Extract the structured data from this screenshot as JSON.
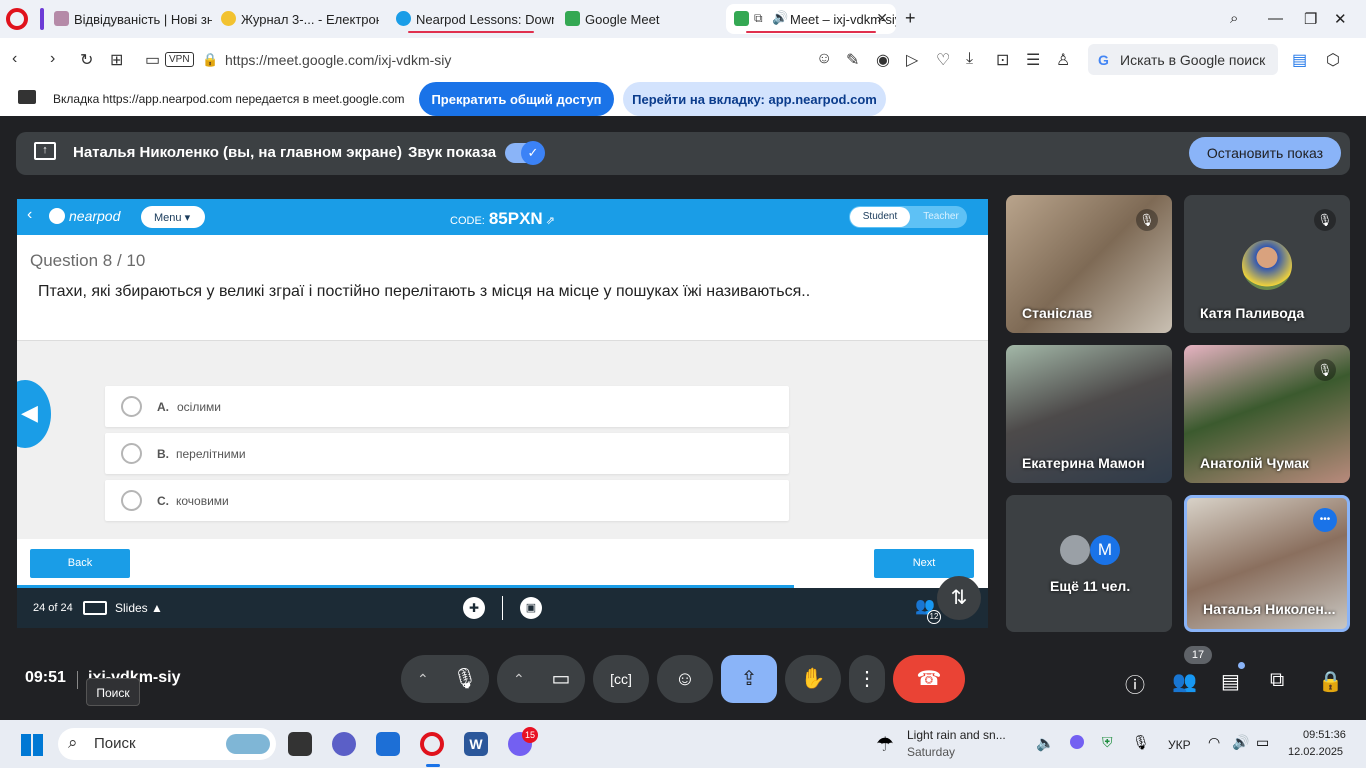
{
  "browser": {
    "tabs": [
      {
        "label": "Відвідуваність | Нові знан"
      },
      {
        "label": "Журнал 3-... - Електронні"
      },
      {
        "label": "Nearpod Lessons: Downlo"
      },
      {
        "label": "Google Meet"
      },
      {
        "label": "Meet – ixj-vdkm-siy"
      }
    ],
    "url": "https://meet.google.com/ixj-vdkm-siy",
    "vpn": "VPN",
    "search_placeholder": "Искать в Google поиск",
    "share_notice": "Вкладка https://app.nearpod.com передается в meet.google.com",
    "stop_sharing": "Прекратить общий доступ",
    "switch_tab": "Перейти на вкладку: app.nearpod.com"
  },
  "presenting": {
    "name": "Наталья Николенко (вы, на главном экране)",
    "audio_label": "Звук показа",
    "stop_label": "Остановить показ"
  },
  "nearpod": {
    "brand": "nearpod",
    "menu": "Menu",
    "code_label": "CODE:",
    "code": "85PXN",
    "student": "Student",
    "teacher": "Teacher",
    "question_num": "Question 8 / 10",
    "question": "Птахи, які збираються у великі зграї і постійно перелітають з місця на місце у пошуках їжі називаються..",
    "options": [
      {
        "letter": "A.",
        "text": "осілими"
      },
      {
        "letter": "B.",
        "text": "перелітними"
      },
      {
        "letter": "C.",
        "text": "кочовими"
      }
    ],
    "back": "Back",
    "next": "Next",
    "slide_count": "24 of 24",
    "slides_label": "Slides",
    "participants_badge": "12"
  },
  "participants": [
    {
      "name": "Станіслав"
    },
    {
      "name": "Катя Паливода"
    },
    {
      "name": "Екатерина Мамон"
    },
    {
      "name": "Анатолій Чумак"
    },
    {
      "name": "Ещё 11 чел.",
      "avatar_letter": "M"
    },
    {
      "name": "Наталья Николен..."
    }
  ],
  "controls": {
    "time": "09:51",
    "meeting_code": "ixj-vdkm-siy",
    "tooltip": "Поиск",
    "people_count": "17"
  },
  "taskbar": {
    "search": "Поиск",
    "weather_line1": "Light rain and sn...",
    "weather_line2": "Saturday",
    "lang": "УКР",
    "time": "09:51:36",
    "date": "12.02.2025",
    "viber_badge": "15"
  }
}
